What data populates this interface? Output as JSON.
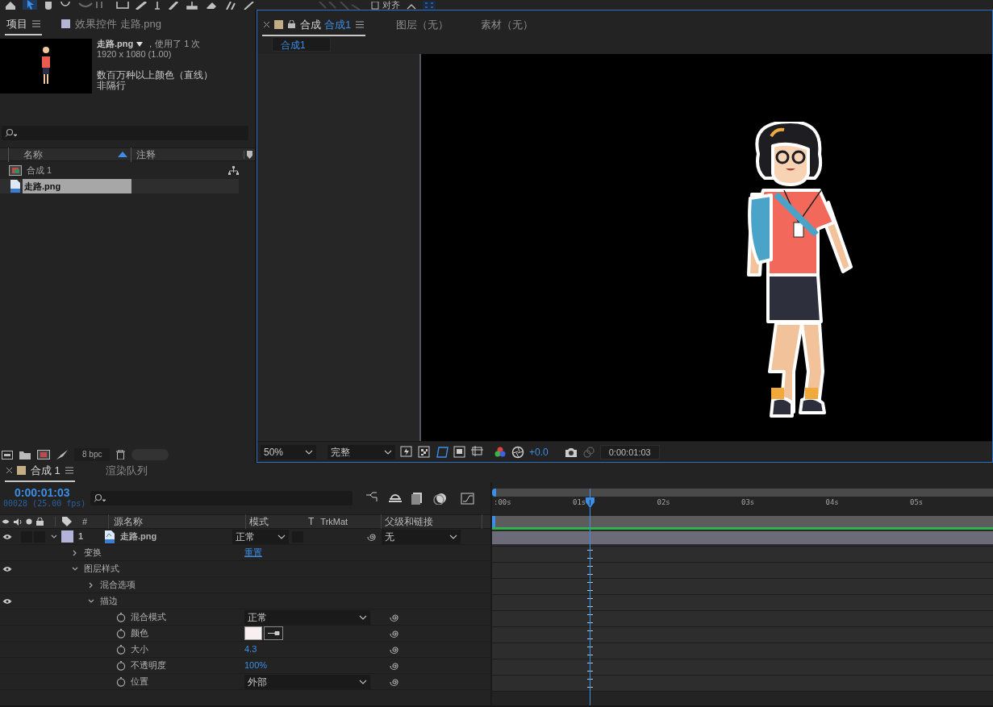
{
  "toolbar": {
    "align_label": "对齐",
    "align_checked": false
  },
  "project_panel": {
    "tabs": [
      {
        "label": "项目",
        "selected": true
      },
      {
        "label": "效果控件 走路.png",
        "selected": false
      }
    ],
    "info": {
      "name": "走路.png",
      "usage": "，使用了 1 次",
      "dimensions": "1920 x 1080 (1.00)",
      "color_depth": "数百万种以上颜色（直线）",
      "field_order": "非隔行"
    },
    "columns": [
      "名称",
      "注释"
    ],
    "items": [
      {
        "kind": "composition",
        "name": "合成 1",
        "selected": false
      },
      {
        "kind": "footage",
        "name": "走路.png",
        "selected": true
      }
    ],
    "bpc": "8 bpc"
  },
  "composition_panel": {
    "tabs": [
      {
        "prefix": "合成",
        "name": "合成1",
        "selected": true
      },
      {
        "prefix": "图层",
        "name": "（无）",
        "selected": false
      },
      {
        "prefix": "素材",
        "name": "（无）",
        "selected": false
      }
    ],
    "breadcrumb": "合成1",
    "zoom": "50%",
    "resolution": "完整",
    "exposure": "+0.0",
    "timecode": "0:00:01:03"
  },
  "timeline": {
    "tabs": [
      {
        "label": "合成 1",
        "selected": true
      },
      {
        "label": "渲染队列",
        "selected": false
      }
    ],
    "timecode": "0:00:01:03",
    "frame_info": "00028 (25.00 fps)",
    "columns": {
      "number": "#",
      "source_name": "源名称",
      "mode": "模式",
      "t": "T",
      "trkmat": "TrkMat",
      "parent": "父级和链接"
    },
    "ruler": [
      ":00s",
      "01s",
      "02s",
      "03s",
      "04s",
      "05s"
    ],
    "render_bar": {
      "level": 1
    },
    "layers": [
      {
        "number": "1",
        "name": "走路.png",
        "color": "#b4b4d8",
        "mode": "正常",
        "parent": "无",
        "visible": true,
        "expanded": true,
        "properties": [
          {
            "kind": "group",
            "name": "变换",
            "visible": false,
            "expanded": false,
            "value": "重置"
          },
          {
            "kind": "group",
            "name": "图层样式",
            "visible": true,
            "expanded": true,
            "children": [
              {
                "kind": "group",
                "name": "混合选项",
                "visible": false,
                "expanded": false
              },
              {
                "kind": "group",
                "name": "描边",
                "visible": true,
                "expanded": true,
                "children": [
                  {
                    "kind": "dropdown",
                    "name": "混合模式",
                    "value": "正常"
                  },
                  {
                    "kind": "color",
                    "name": "颜色",
                    "color": "#f8f0f0"
                  },
                  {
                    "kind": "number",
                    "name": "大小",
                    "value": "4.3"
                  },
                  {
                    "kind": "number",
                    "name": "不透明度",
                    "value": "100%"
                  },
                  {
                    "kind": "dropdown",
                    "name": "位置",
                    "value": "外部"
                  }
                ]
              }
            ]
          }
        ]
      }
    ]
  }
}
